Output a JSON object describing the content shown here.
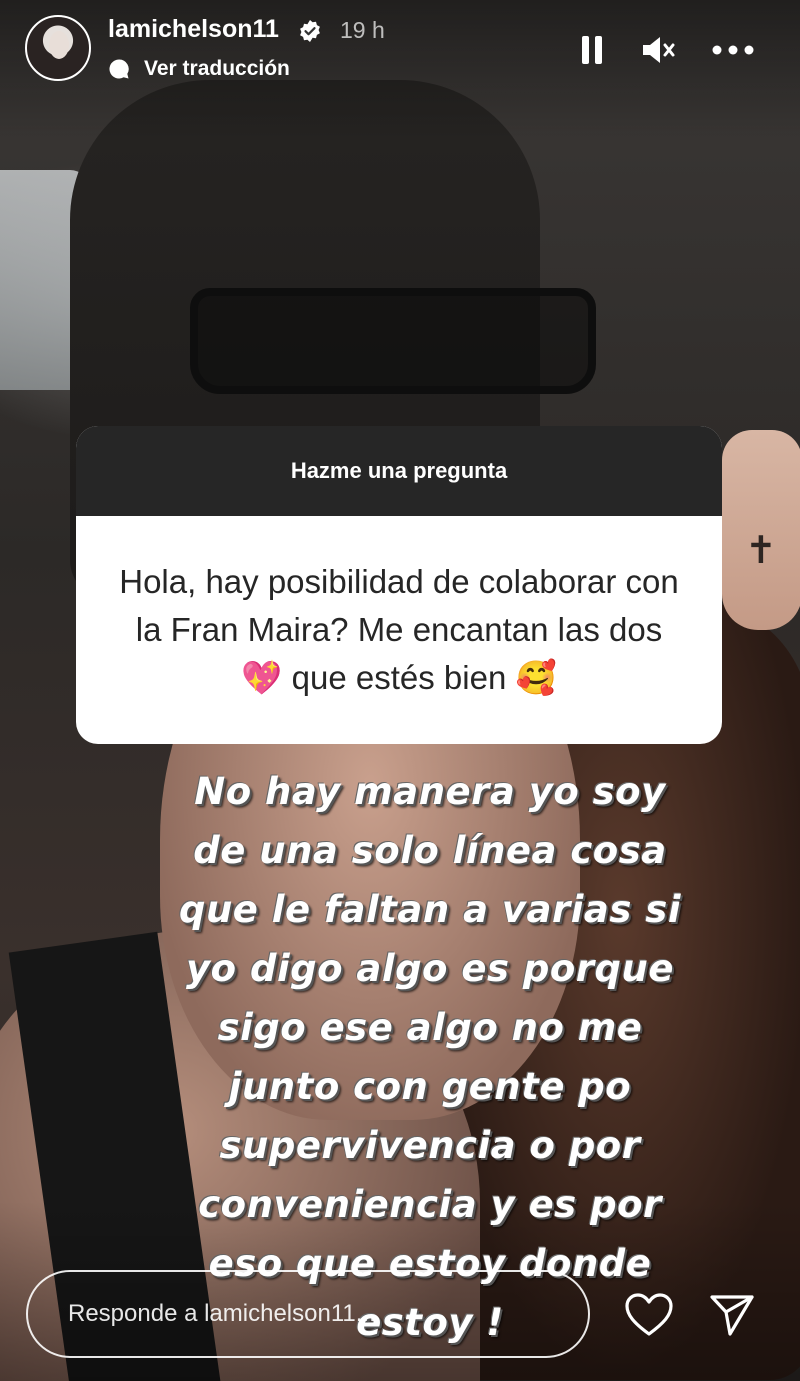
{
  "header": {
    "username": "lamichelson11",
    "time": "19 h",
    "translate_label": "Ver traducción"
  },
  "sticker": {
    "title": "Hazme una pregunta",
    "question": "Hola, hay posibilidad de colaborar con la Fran Maira? Me encantan las dos 💖 que estés bien 🥰"
  },
  "caption": {
    "lines": [
      "No hay manera yo soy",
      "de una solo línea cosa",
      "que le faltan a varias si",
      "yo digo algo es porque",
      "sigo ese algo no me",
      "junto con gente po",
      "supervivencia o por",
      "conveniencia y es por",
      "eso que estoy donde",
      "estoy !"
    ]
  },
  "footer": {
    "reply_placeholder": "Responde a lamichelson11..."
  },
  "icons": {
    "verified": "verified-badge-icon",
    "translate": "speech-bubble-icon",
    "pause": "pause-icon",
    "mute": "speaker-muted-icon",
    "more": "more-horizontal-icon",
    "heart": "heart-icon",
    "send": "paper-plane-icon"
  }
}
